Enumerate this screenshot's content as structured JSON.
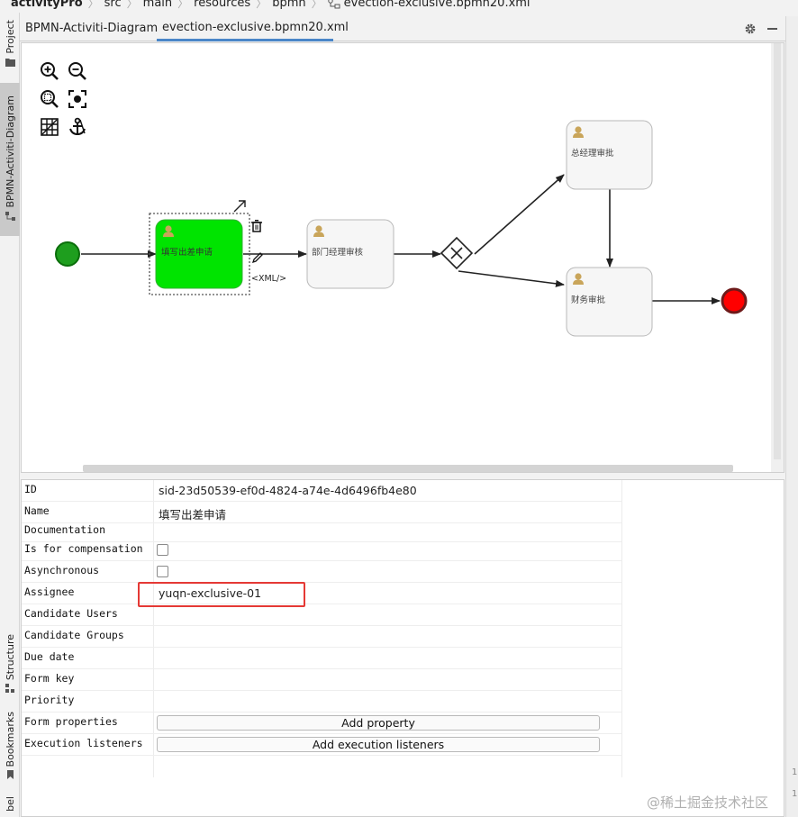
{
  "breadcrumb": [
    "activityPro",
    "src",
    "main",
    "resources",
    "bpmn",
    "evection-exclusive.bpmn20.xml"
  ],
  "left_strip": {
    "project": "Project",
    "bpmn_diagram": "BPMN-Activiti-Diagram",
    "structure": "Structure",
    "bookmarks": "Bookmarks",
    "bottom_cut": "bel"
  },
  "tabs": [
    {
      "label": "BPMN-Activiti-Diagram",
      "active": false
    },
    {
      "label": "evection-exclusive.bpmn20.xml",
      "active": true
    }
  ],
  "toolbar": [
    "zoom-in-icon",
    "zoom-out-icon",
    "zoom-fit-icon",
    "zoom-actual-icon",
    "grid-icon",
    "anchor-icon"
  ],
  "diagram": {
    "task_fill": "填写出差申请",
    "task_dept": "部门经理审核",
    "task_gm": "总经理审批",
    "task_finance": "财务审批",
    "xml_label": "<XML/>",
    "active_color": "#00e400",
    "end_color": "#ff0000",
    "start_color": "#1e9e1e"
  },
  "properties": [
    {
      "label": "ID",
      "value": "sid-23d50539-ef0d-4824-a74e-4d6496fb4e80",
      "kind": "text"
    },
    {
      "label": "Name",
      "value": "填写出差申请",
      "kind": "text"
    },
    {
      "label": "Documentation",
      "value": "",
      "kind": "text"
    },
    {
      "label": "Is for compensation",
      "value": "",
      "kind": "checkbox"
    },
    {
      "label": "Asynchronous",
      "value": "",
      "kind": "checkbox"
    },
    {
      "label": "Assignee",
      "value": "yuqn-exclusive-01",
      "kind": "text"
    },
    {
      "label": "Candidate Users",
      "value": "",
      "kind": "text"
    },
    {
      "label": "Candidate Groups",
      "value": "",
      "kind": "text"
    },
    {
      "label": "Due date",
      "value": "",
      "kind": "text"
    },
    {
      "label": "Form key",
      "value": "",
      "kind": "text"
    },
    {
      "label": "Priority",
      "value": "",
      "kind": "text"
    },
    {
      "label": "Form properties",
      "value": "Add property",
      "kind": "button"
    },
    {
      "label": "Execution listeners",
      "value": "Add execution listeners",
      "kind": "button"
    }
  ],
  "gutter": [
    "1",
    "1"
  ],
  "watermark": "@稀土掘金技术社区"
}
